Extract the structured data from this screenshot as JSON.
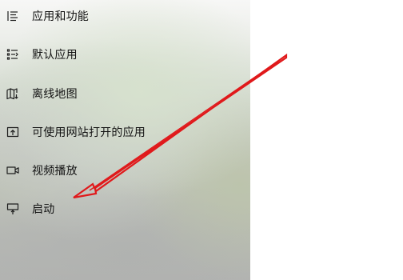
{
  "menu": {
    "items": [
      {
        "label": "应用和功能",
        "icon": "apps-list-icon"
      },
      {
        "label": "默认应用",
        "icon": "default-apps-icon"
      },
      {
        "label": "离线地图",
        "icon": "offline-map-icon"
      },
      {
        "label": "可使用网站打开的应用",
        "icon": "apps-for-websites-icon"
      },
      {
        "label": "视频播放",
        "icon": "video-playback-icon"
      },
      {
        "label": "启动",
        "icon": "startup-icon"
      }
    ]
  },
  "colors": {
    "text": "#141414",
    "icon": "#1e1e1e",
    "annotation_arrow": "#e0191b"
  }
}
